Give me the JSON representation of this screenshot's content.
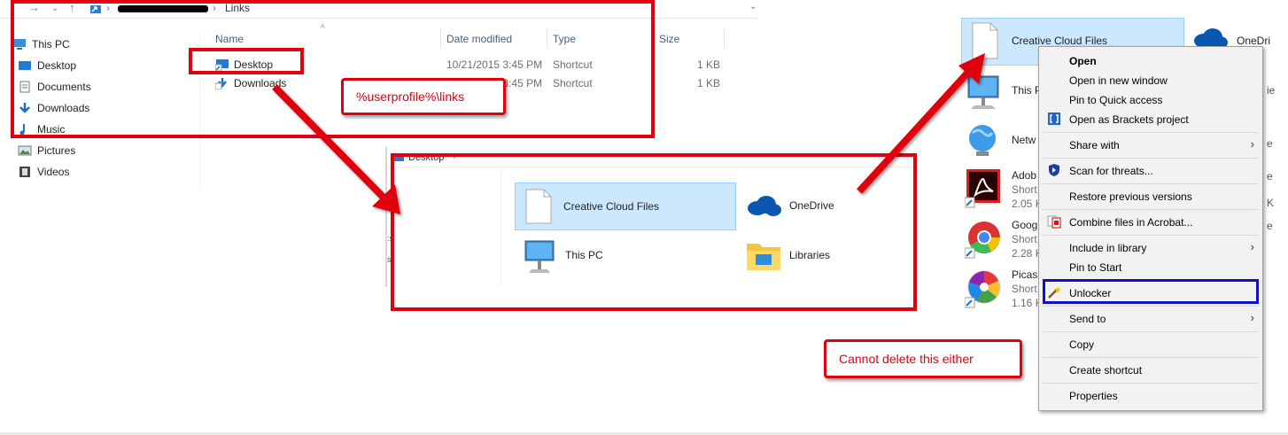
{
  "explorer": {
    "address_current": "Links",
    "nav_items": [
      "This PC",
      "Desktop",
      "Documents",
      "Downloads",
      "Music",
      "Pictures",
      "Videos"
    ],
    "columns": [
      "Name",
      "Date modified",
      "Type",
      "Size"
    ],
    "rows": [
      {
        "name": "Desktop",
        "date": "10/21/2015 3:45 PM",
        "type": "Shortcut",
        "size": "1 KB"
      },
      {
        "name": "Downloads",
        "date": "10/21/2015 3:45 PM",
        "type": "Shortcut",
        "size": "1 KB"
      }
    ]
  },
  "desktop_window": {
    "address_current": "Desktop",
    "items": [
      "Creative Cloud Files",
      "OneDrive",
      "This PC",
      "Libraries"
    ]
  },
  "desktop_right": {
    "selected": "Creative Cloud Files",
    "onedrive": "OneDri",
    "this_pc": "This P",
    "network": "Netw",
    "adobe": {
      "name": "Adob",
      "sub1": "Short",
      "sub2": "2.05 K"
    },
    "google": {
      "name": "Goog",
      "sub1": "Short",
      "sub2": "2.28 K"
    },
    "picasa": {
      "name": "Picas",
      "sub1": "Short",
      "sub2": "1.16 K"
    }
  },
  "context_menu": {
    "open": "Open",
    "open_new_window": "Open in new window",
    "pin_quick_access": "Pin to Quick access",
    "open_brackets": "Open as Brackets project",
    "share_with": "Share with",
    "scan_threats": "Scan for threats...",
    "restore_versions": "Restore previous versions",
    "combine_acrobat": "Combine files in Acrobat...",
    "include_library": "Include in library",
    "pin_start": "Pin to Start",
    "unlocker": "Unlocker",
    "send_to": "Send to",
    "copy": "Copy",
    "create_shortcut": "Create shortcut",
    "properties": "Properties"
  },
  "annotations": {
    "path_note": "%userprofile%\\links",
    "cannot_delete": "Cannot delete this either"
  },
  "colors": {
    "annotation_red": "#e0000f",
    "highlight_blue": "#1010c8",
    "selection": "#cce8ff"
  }
}
